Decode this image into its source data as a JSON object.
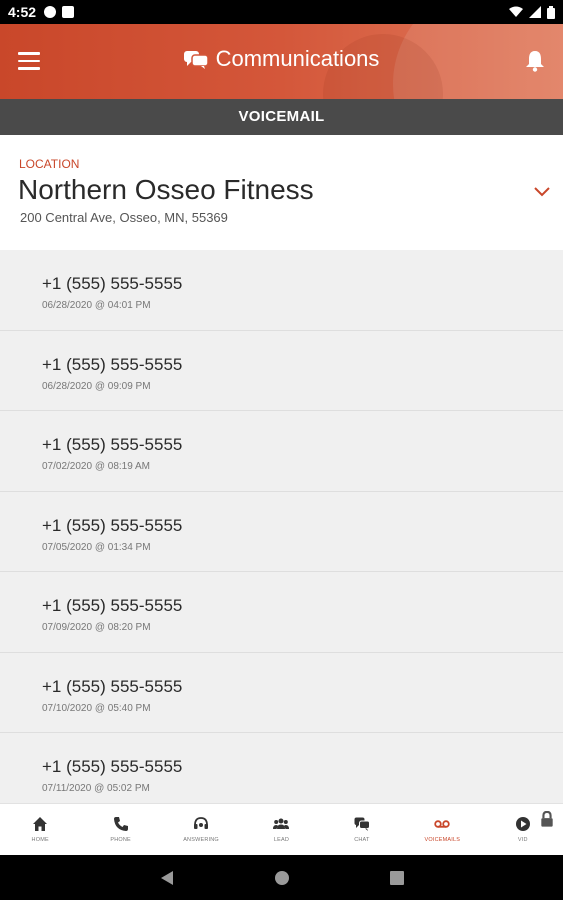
{
  "status_bar": {
    "time": "4:52"
  },
  "header": {
    "title": "Communications"
  },
  "section": {
    "title": "VOICEMAIL"
  },
  "location": {
    "label": "LOCATION",
    "name": "Northern Osseo Fitness",
    "address": "200 Central Ave, Osseo, MN, 55369"
  },
  "voicemails": [
    {
      "number": "+1 (555) 555-5555",
      "timestamp": "06/28/2020 @ 04:01 PM"
    },
    {
      "number": "+1 (555) 555-5555",
      "timestamp": "06/28/2020 @ 09:09 PM"
    },
    {
      "number": "+1 (555) 555-5555",
      "timestamp": "07/02/2020 @ 08:19 AM"
    },
    {
      "number": "+1 (555) 555-5555",
      "timestamp": "07/05/2020 @ 01:34 PM"
    },
    {
      "number": "+1 (555) 555-5555",
      "timestamp": "07/09/2020 @ 08:20 PM"
    },
    {
      "number": "+1 (555) 555-5555",
      "timestamp": "07/10/2020 @ 05:40 PM"
    },
    {
      "number": "+1 (555) 555-5555",
      "timestamp": "07/11/2020 @ 05:02 PM"
    }
  ],
  "bottom_nav": [
    {
      "label": "HOME",
      "icon": "home-icon"
    },
    {
      "label": "PHONE",
      "icon": "phone-icon"
    },
    {
      "label": "ANSWERING",
      "icon": "headset-icon"
    },
    {
      "label": "LEAD",
      "icon": "people-icon"
    },
    {
      "label": "CHAT",
      "icon": "chat-icon"
    },
    {
      "label": "VOICEMAILS",
      "icon": "voicemail-icon",
      "active": true
    },
    {
      "label": "VID",
      "icon": "play-icon",
      "locked": true
    }
  ],
  "colors": {
    "accent": "#c9472a",
    "section_bar": "#4a4a4a",
    "list_bg": "#f0f0f0"
  }
}
